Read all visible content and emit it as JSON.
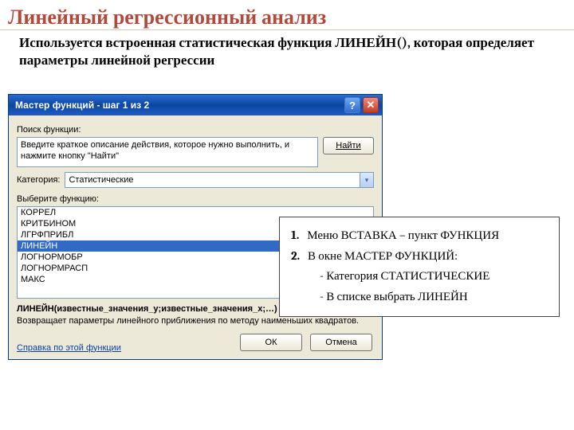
{
  "page": {
    "title": "Линейный регрессионный анализ",
    "intro_before": "Используется встроенная статистическая функция ",
    "intro_fn": "ЛИНЕЙН()",
    "intro_after": ", которая определяет параметры линейной регрессии"
  },
  "dialog": {
    "title": "Мастер функций - шаг 1 из 2",
    "search_label": "Поиск функции:",
    "search_text": "Введите краткое описание действия, которое нужно выполнить, и нажмите кнопку \"Найти\"",
    "find_btn": "Найти",
    "category_label": "Категория:",
    "category_value": "Статистические",
    "select_label": "Выберите функцию:",
    "list": {
      "i0": "КОРРЕЛ",
      "i1": "КРИТБИНОМ",
      "i2": "ЛГРФПРИБЛ",
      "i3": "ЛИНЕЙН",
      "i4": "ЛОГНОРМОБР",
      "i5": "ЛОГНОРМРАСП",
      "i6": "МАКС"
    },
    "sig": "ЛИНЕЙН(известные_значения_y;известные_значения_x;…)",
    "desc": "Возвращает параметры линейного приближения по методу наименьших квадратов.",
    "help_link": "Справка по этой функции",
    "ok": "ОК",
    "cancel": "Отмена"
  },
  "callout": {
    "line1_num": "1.",
    "line1": "Меню ВСТАВКА – пункт ФУНКЦИЯ",
    "line2_num": "2.",
    "line2": "В окне МАСТЕР ФУНКЦИЙ:",
    "sub1": "- Категория СТАТИСТИЧЕСКИЕ",
    "sub2": "- В списке выбрать ЛИНЕЙН"
  }
}
